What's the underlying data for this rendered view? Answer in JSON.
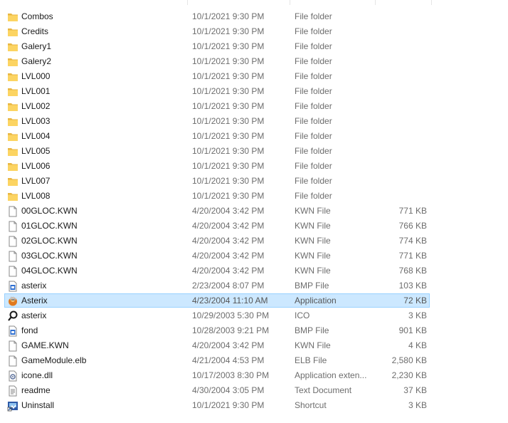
{
  "files": [
    {
      "name": "Combos",
      "date": "10/1/2021 9:30 PM",
      "type": "File folder",
      "size": "",
      "icon": "folder-icon"
    },
    {
      "name": "Credits",
      "date": "10/1/2021 9:30 PM",
      "type": "File folder",
      "size": "",
      "icon": "folder-icon"
    },
    {
      "name": "Galery1",
      "date": "10/1/2021 9:30 PM",
      "type": "File folder",
      "size": "",
      "icon": "folder-icon"
    },
    {
      "name": "Galery2",
      "date": "10/1/2021 9:30 PM",
      "type": "File folder",
      "size": "",
      "icon": "folder-icon"
    },
    {
      "name": "LVL000",
      "date": "10/1/2021 9:30 PM",
      "type": "File folder",
      "size": "",
      "icon": "folder-icon"
    },
    {
      "name": "LVL001",
      "date": "10/1/2021 9:30 PM",
      "type": "File folder",
      "size": "",
      "icon": "folder-icon"
    },
    {
      "name": "LVL002",
      "date": "10/1/2021 9:30 PM",
      "type": "File folder",
      "size": "",
      "icon": "folder-icon"
    },
    {
      "name": "LVL003",
      "date": "10/1/2021 9:30 PM",
      "type": "File folder",
      "size": "",
      "icon": "folder-icon"
    },
    {
      "name": "LVL004",
      "date": "10/1/2021 9:30 PM",
      "type": "File folder",
      "size": "",
      "icon": "folder-icon"
    },
    {
      "name": "LVL005",
      "date": "10/1/2021 9:30 PM",
      "type": "File folder",
      "size": "",
      "icon": "folder-icon"
    },
    {
      "name": "LVL006",
      "date": "10/1/2021 9:30 PM",
      "type": "File folder",
      "size": "",
      "icon": "folder-icon"
    },
    {
      "name": "LVL007",
      "date": "10/1/2021 9:30 PM",
      "type": "File folder",
      "size": "",
      "icon": "folder-icon"
    },
    {
      "name": "LVL008",
      "date": "10/1/2021 9:30 PM",
      "type": "File folder",
      "size": "",
      "icon": "folder-icon"
    },
    {
      "name": "00GLOC.KWN",
      "date": "4/20/2004 3:42 PM",
      "type": "KWN File",
      "size": "771 KB",
      "icon": "file-icon"
    },
    {
      "name": "01GLOC.KWN",
      "date": "4/20/2004 3:42 PM",
      "type": "KWN File",
      "size": "766 KB",
      "icon": "file-icon"
    },
    {
      "name": "02GLOC.KWN",
      "date": "4/20/2004 3:42 PM",
      "type": "KWN File",
      "size": "774 KB",
      "icon": "file-icon"
    },
    {
      "name": "03GLOC.KWN",
      "date": "4/20/2004 3:42 PM",
      "type": "KWN File",
      "size": "771 KB",
      "icon": "file-icon"
    },
    {
      "name": "04GLOC.KWN",
      "date": "4/20/2004 3:42 PM",
      "type": "KWN File",
      "size": "768 KB",
      "icon": "file-icon"
    },
    {
      "name": "asterix",
      "date": "2/23/2004 8:07 PM",
      "type": "BMP File",
      "size": "103 KB",
      "icon": "bmp-icon"
    },
    {
      "name": "Asterix",
      "date": "4/23/2004 11:10 AM",
      "type": "Application",
      "size": "72 KB",
      "icon": "asterix-app-icon",
      "selected": true
    },
    {
      "name": "asterix",
      "date": "10/29/2003 5:30 PM",
      "type": "ICO",
      "size": "3 KB",
      "icon": "ico-icon"
    },
    {
      "name": "fond",
      "date": "10/28/2003 9:21 PM",
      "type": "BMP File",
      "size": "901 KB",
      "icon": "bmp-icon"
    },
    {
      "name": "GAME.KWN",
      "date": "4/20/2004 3:42 PM",
      "type": "KWN File",
      "size": "4 KB",
      "icon": "file-icon"
    },
    {
      "name": "GameModule.elb",
      "date": "4/21/2004 4:53 PM",
      "type": "ELB File",
      "size": "2,580 KB",
      "icon": "file-icon"
    },
    {
      "name": "icone.dll",
      "date": "10/17/2003 8:30 PM",
      "type": "Application exten...",
      "size": "2,230 KB",
      "icon": "dll-icon"
    },
    {
      "name": "readme",
      "date": "4/30/2004 3:05 PM",
      "type": "Text Document",
      "size": "37 KB",
      "icon": "text-document-icon"
    },
    {
      "name": "Uninstall",
      "date": "10/1/2021 9:30 PM",
      "type": "Shortcut",
      "size": "3 KB",
      "icon": "uninstall-shortcut-icon"
    }
  ]
}
